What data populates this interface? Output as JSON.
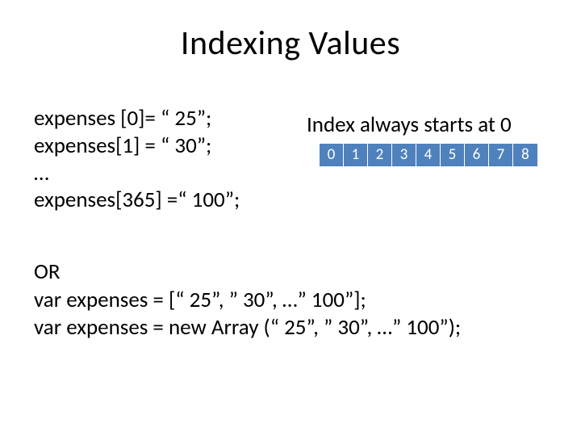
{
  "title": "Indexing Values",
  "lines": {
    "l0": "expenses [0]= “ 25”;",
    "l1": "expenses[1] = “ 30”;",
    "l2": "…",
    "l3": "expenses[365] =“ 100”;"
  },
  "caption": "Index always starts at 0",
  "indices": [
    "0",
    "1",
    "2",
    "3",
    "4",
    "5",
    "6",
    "7",
    "8"
  ],
  "bottom": {
    "b0": "OR",
    "b1": "var expenses = [“ 25”, ” 30”, …” 100”];",
    "b2": "var expenses = new Array (“ 25”, ” 30”, …” 100”);"
  }
}
